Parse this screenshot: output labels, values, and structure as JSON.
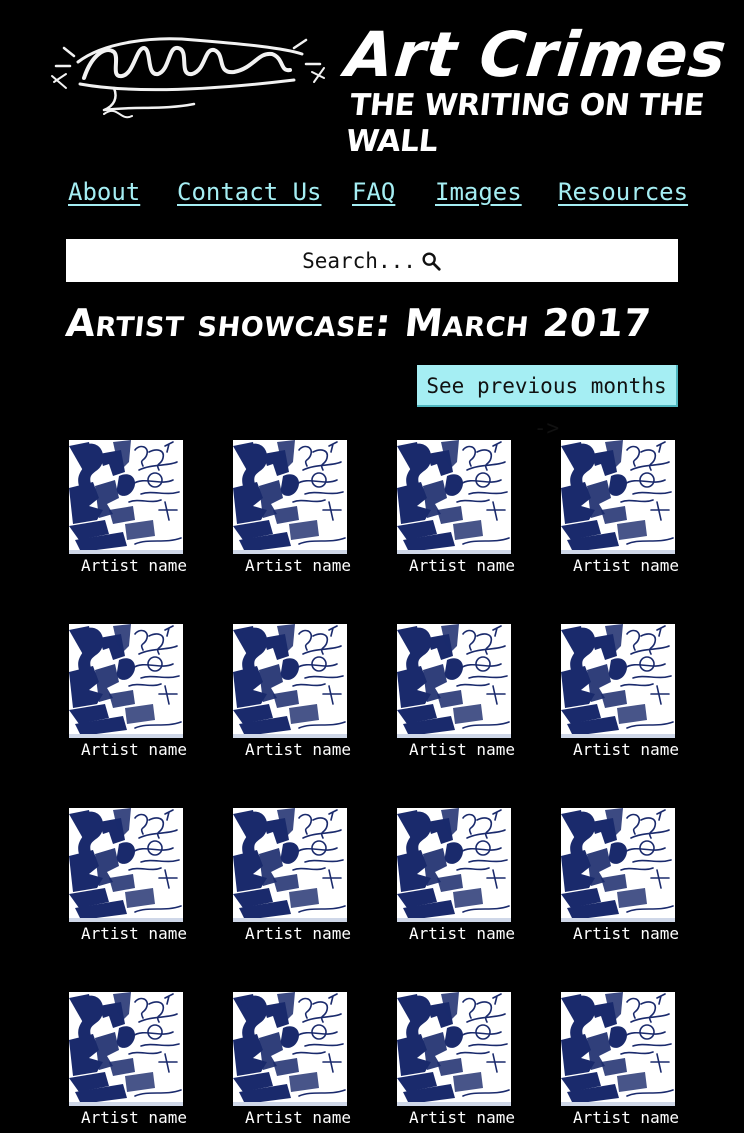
{
  "site": {
    "logo_alt": "artcrimes",
    "title": "Art Crimes",
    "tagline": "THE WRITING ON THE WALL"
  },
  "nav": [
    {
      "label": "About"
    },
    {
      "label": "Contact Us"
    },
    {
      "label": "FAQ"
    },
    {
      "label": "Images"
    },
    {
      "label": "Resources"
    }
  ],
  "search": {
    "placeholder": "Search...",
    "icon": "search-icon"
  },
  "page": {
    "title": "Artist showcase: March 2017",
    "prev_button": "See previous months ->"
  },
  "gallery": [
    {
      "artist": "Artist name"
    },
    {
      "artist": "Artist name"
    },
    {
      "artist": "Artist name"
    },
    {
      "artist": "Artist name"
    },
    {
      "artist": "Artist name"
    },
    {
      "artist": "Artist name"
    },
    {
      "artist": "Artist name"
    },
    {
      "artist": "Artist name"
    },
    {
      "artist": "Artist name"
    },
    {
      "artist": "Artist name"
    },
    {
      "artist": "Artist name"
    },
    {
      "artist": "Artist name"
    },
    {
      "artist": "Artist name"
    },
    {
      "artist": "Artist name"
    },
    {
      "artist": "Artist name"
    },
    {
      "artist": "Artist name"
    }
  ],
  "colors": {
    "background": "#000000",
    "accent": "#a5eef3",
    "text": "#ffffff",
    "thumb_ink": "#1a2a6c"
  }
}
